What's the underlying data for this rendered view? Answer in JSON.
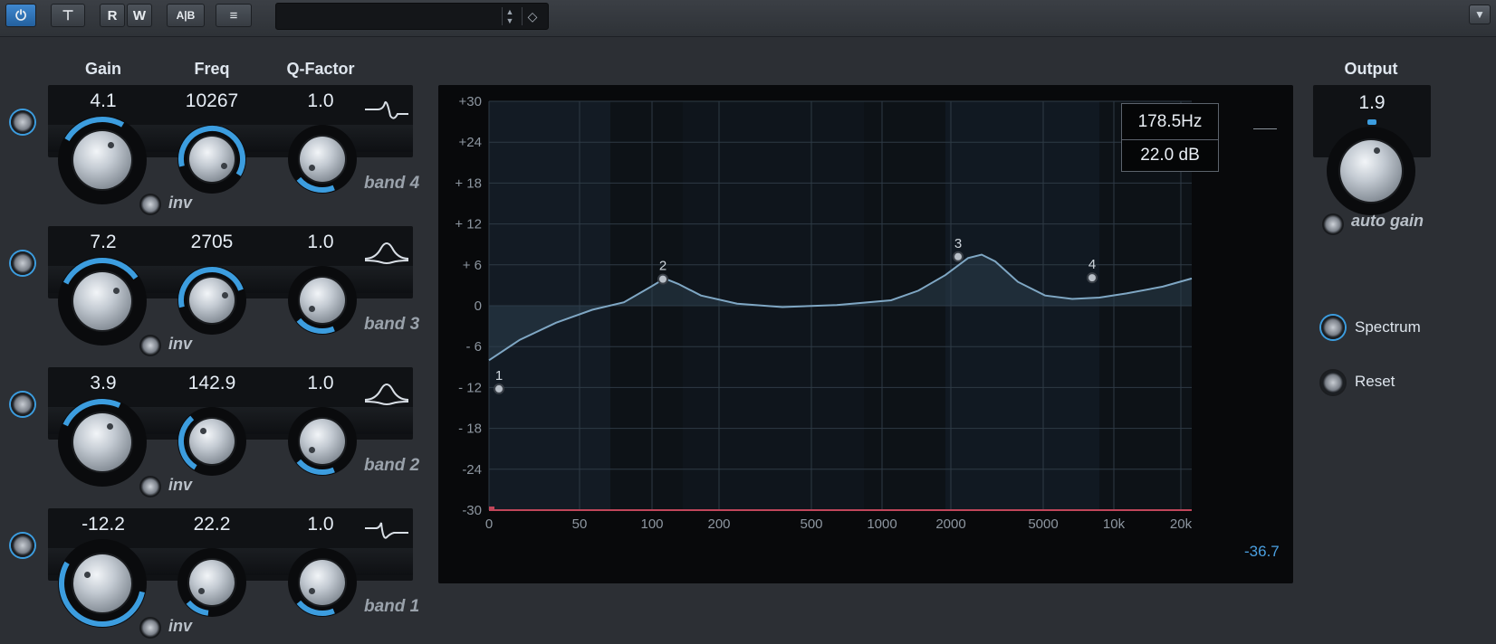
{
  "toolbar": {
    "power_label": "⏻",
    "bypass_label": "⊤",
    "read_label": "R",
    "write_label": "W",
    "ab_label": "A|B",
    "menu_label": "≡",
    "preset_name": "",
    "store_label": "◇"
  },
  "columns": {
    "gain": "Gain",
    "freq": "Freq",
    "q": "Q-Factor",
    "output": "Output"
  },
  "bands": [
    {
      "label": "band 4",
      "gain": "4.1",
      "freq": "10267",
      "q": "1.0",
      "inv": "inv",
      "shape": "high-shelf-icon"
    },
    {
      "label": "band 3",
      "gain": "7.2",
      "freq": "2705",
      "q": "1.0",
      "inv": "inv",
      "shape": "peak-icon"
    },
    {
      "label": "band 2",
      "gain": "3.9",
      "freq": "142.9",
      "q": "1.0",
      "inv": "inv",
      "shape": "peak-icon"
    },
    {
      "label": "band 1",
      "gain": "-12.2",
      "freq": "22.2",
      "q": "1.0",
      "inv": "inv",
      "shape": "low-shelf-icon"
    }
  ],
  "graph": {
    "y_ticks": [
      "+30",
      "+24",
      "+ 18",
      "+ 12",
      "+ 6",
      "0",
      "- 6",
      "- 12",
      "- 18",
      "-24",
      "-30"
    ],
    "x_ticks": [
      "0",
      "50",
      "100",
      "200",
      "500",
      "1000",
      "2000",
      "5000",
      "10k",
      "20k"
    ],
    "readout_freq": "178.5Hz",
    "readout_db": "22.0 dB",
    "meter_value": "-36.7",
    "points": [
      "1",
      "2",
      "3",
      "4"
    ]
  },
  "output": {
    "value": "1.9",
    "auto_gain": "auto gain"
  },
  "options": {
    "spectrum": "Spectrum",
    "reset": "Reset"
  },
  "colors": {
    "accent": "#3c9ddf",
    "curve": "#7fa7c4",
    "zero_marker": "#c0465a"
  }
}
